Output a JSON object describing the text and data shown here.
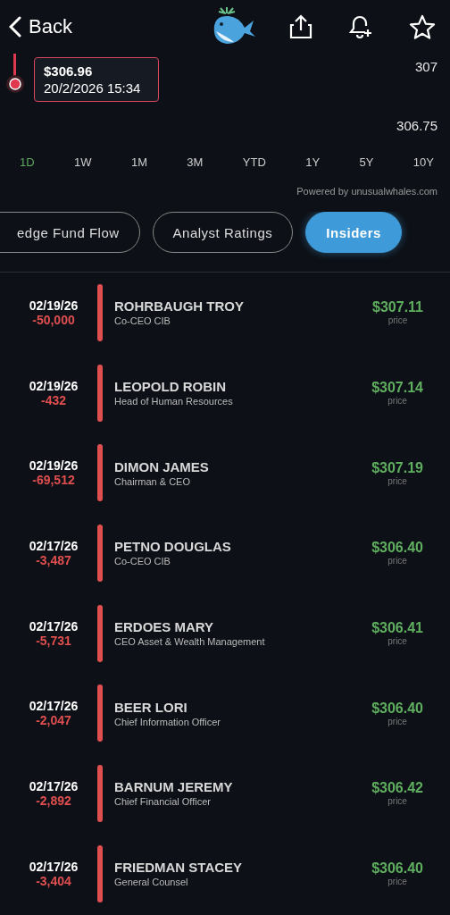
{
  "header": {
    "back": "Back"
  },
  "chart": {
    "tooltip": {
      "price": "$306.96",
      "time": "20/2/2026 15:34"
    },
    "axis_labels": [
      "307",
      "306.75"
    ]
  },
  "timeframes": [
    {
      "label": "1D",
      "selected": true
    },
    {
      "label": "1W",
      "selected": false
    },
    {
      "label": "1M",
      "selected": false
    },
    {
      "label": "3M",
      "selected": false
    },
    {
      "label": "YTD",
      "selected": false
    },
    {
      "label": "1Y",
      "selected": false
    },
    {
      "label": "5Y",
      "selected": false
    },
    {
      "label": "10Y",
      "selected": false
    }
  ],
  "powered_by": "Powered by unusualwhales.com",
  "tabs": [
    {
      "label": "edge Fund Flow",
      "selected": false
    },
    {
      "label": "Analyst Ratings",
      "selected": false
    },
    {
      "label": "Insiders",
      "selected": true
    }
  ],
  "trades": [
    {
      "date": "02/19/26",
      "shares": "-50,000",
      "name": "ROHRBAUGH TROY",
      "title": "Co-CEO CIB",
      "price": "$307.11",
      "price_label": "price"
    },
    {
      "date": "02/19/26",
      "shares": "-432",
      "name": "LEOPOLD ROBIN",
      "title": "Head of Human Resources",
      "price": "$307.14",
      "price_label": "price"
    },
    {
      "date": "02/19/26",
      "shares": "-69,512",
      "name": "DIMON JAMES",
      "title": "Chairman & CEO",
      "price": "$307.19",
      "price_label": "price"
    },
    {
      "date": "02/17/26",
      "shares": "-3,487",
      "name": "PETNO DOUGLAS",
      "title": "Co-CEO CIB",
      "price": "$306.40",
      "price_label": "price"
    },
    {
      "date": "02/17/26",
      "shares": "-5,731",
      "name": "ERDOES MARY",
      "title": "CEO Asset & Wealth Management",
      "price": "$306.41",
      "price_label": "price"
    },
    {
      "date": "02/17/26",
      "shares": "-2,047",
      "name": "BEER LORI",
      "title": "Chief Information Officer",
      "price": "$306.40",
      "price_label": "price"
    },
    {
      "date": "02/17/26",
      "shares": "-2,892",
      "name": "BARNUM JEREMY",
      "title": "Chief Financial Officer",
      "price": "$306.42",
      "price_label": "price"
    },
    {
      "date": "02/17/26",
      "shares": "-3,404",
      "name": "FRIEDMAN STACEY",
      "title": "General Counsel",
      "price": "$306.40",
      "price_label": "price"
    }
  ]
}
